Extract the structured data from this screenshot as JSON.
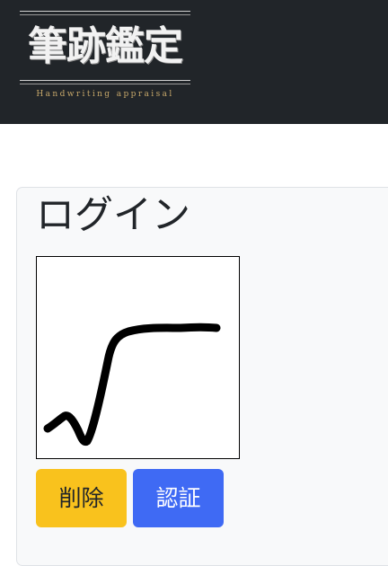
{
  "header": {
    "logo": {
      "title": "筆跡鑑定",
      "subtitle": "Handwriting appraisal"
    }
  },
  "login": {
    "title": "ログイン",
    "canvas": {
      "icon": "signature-stroke"
    },
    "buttons": {
      "clear_label": "削除",
      "auth_label": "認証"
    }
  },
  "colors": {
    "header_bg": "#212529",
    "card_bg": "#f8f9fa",
    "clear_button": "#f9c21d",
    "auth_button": "#3f6af4"
  }
}
